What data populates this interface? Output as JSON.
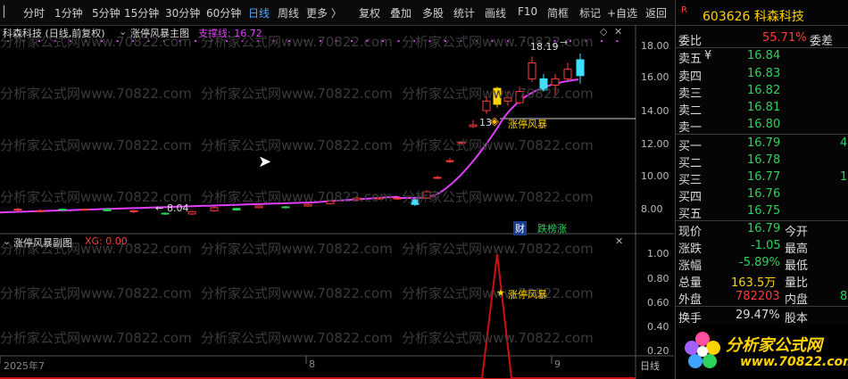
{
  "toolbar": {
    "periods": [
      "分时",
      "1分钟",
      "5分钟",
      "15分钟",
      "30分钟",
      "60分钟",
      "日线",
      "周线",
      "更多 〉"
    ],
    "active_period": "日线",
    "tools": [
      "复权",
      "叠加",
      "多股",
      "统计",
      "画线",
      "F10",
      "简框",
      "标记",
      "+自选",
      "返回"
    ]
  },
  "main_chart": {
    "stock_label": "科森科技 (日线,前复权)",
    "indicator_name": "涨停风暴主图",
    "support_label": "支撑线: 16.72",
    "high_marker": "18.19",
    "low_marker": "8.04",
    "signal_label": "涨停风暴",
    "signal_prefix": "13",
    "badge_cai": "财",
    "badge_rank": "跌榜涨",
    "y_ticks": [
      "18.00",
      "16.00",
      "14.00",
      "12.00",
      "10.00",
      "8.00"
    ]
  },
  "sub_chart": {
    "indicator_name": "涨停风暴副图",
    "value_label": "XG: 0.00",
    "signal_label": "涨停风暴",
    "y_ticks": [
      "1.00",
      "0.80",
      "0.60",
      "0.40",
      "0.20"
    ]
  },
  "time_axis": {
    "labels": [
      "2025年7",
      "8",
      "9"
    ],
    "period_label": "日线"
  },
  "watermark": "分析家公式网www.70822.com",
  "quote": {
    "r_badge": "R",
    "code_name": "603626 科森科技",
    "weibi_label": "委比",
    "weibi_value": "55.71%",
    "weicha_label": "委差",
    "asks": [
      {
        "label": "卖五",
        "mark": "¥",
        "price": "16.84"
      },
      {
        "label": "卖四",
        "mark": "",
        "price": "16.83"
      },
      {
        "label": "卖三",
        "mark": "",
        "price": "16.82"
      },
      {
        "label": "卖二",
        "mark": "",
        "price": "16.81"
      },
      {
        "label": "卖一",
        "mark": "",
        "price": "16.80"
      }
    ],
    "bids": [
      {
        "label": "买一",
        "price": "16.79",
        "vol": "4"
      },
      {
        "label": "买二",
        "price": "16.78",
        "vol": ""
      },
      {
        "label": "买三",
        "price": "16.77",
        "vol": "1"
      },
      {
        "label": "买四",
        "price": "16.76",
        "vol": ""
      },
      {
        "label": "买五",
        "price": "16.75",
        "vol": ""
      }
    ],
    "stats": [
      {
        "label": "现价",
        "value": "16.79",
        "label2": "今开"
      },
      {
        "label": "涨跌",
        "value": "-1.05",
        "label2": "最高"
      },
      {
        "label": "涨幅",
        "value": "-5.89%",
        "label2": "最低"
      },
      {
        "label": "总量",
        "value": "163.5万",
        "label2": "量比"
      },
      {
        "label": "外盘",
        "value": "782203",
        "label2": "内盘",
        "extra": "8"
      }
    ],
    "turnover_label": "换手",
    "turnover_value": "29.47%",
    "share_label": "股本"
  },
  "logo": {
    "name": "分析家公式网",
    "url": "www.70822.com"
  },
  "colors": {
    "up": "#ff3b3b",
    "down": "#2dd25a",
    "support": "#e040fb",
    "signal": "#ffd400",
    "accent": "#4ea8ff",
    "sub_line": "#d01010"
  },
  "chart_data": {
    "type": "candlestick",
    "series": [
      {
        "name": "支撑线",
        "y_last": 16.72
      },
      {
        "name": "XG",
        "values": [
          0,
          0,
          0,
          0,
          0,
          0,
          0,
          0,
          0,
          1,
          0,
          0,
          0,
          0,
          0
        ]
      }
    ],
    "ylim_main": [
      7.5,
      19
    ],
    "ylim_sub": [
      0,
      1.2
    ]
  }
}
